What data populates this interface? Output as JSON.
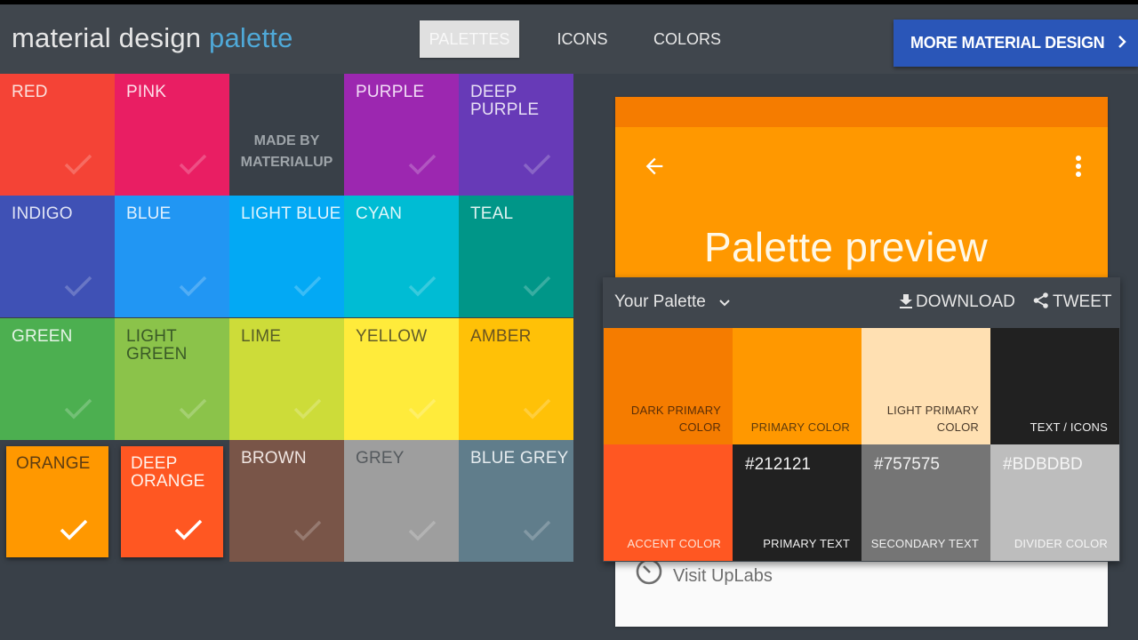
{
  "header": {
    "logo_main": "material design ",
    "logo_accent": "palette",
    "nav": [
      {
        "label": "PALETTES",
        "active": true
      },
      {
        "label": "ICONS",
        "active": false
      },
      {
        "label": "COLORS",
        "active": false
      }
    ],
    "more_button": "MORE MATERIAL DESIGN",
    "more_button_icon": "chevron-right-icon"
  },
  "grid": {
    "tiles": [
      {
        "name": "RED",
        "color": "#f44336",
        "text": "#fbe0dd",
        "selected": false
      },
      {
        "name": "PINK",
        "color": "#e91e63",
        "text": "#fce0ea",
        "selected": false
      },
      {
        "name": "MADE_BY",
        "color": "#394048",
        "text": "#9ea4a9",
        "selected": false
      },
      {
        "name": "PURPLE",
        "color": "#9c27b0",
        "text": "#f2ddf6",
        "selected": false
      },
      {
        "name": "DEEP PURPLE",
        "color": "#673ab7",
        "text": "#e7dff4",
        "selected": false
      },
      {
        "name": "INDIGO",
        "color": "#3f51b5",
        "text": "#e0e4f5",
        "selected": false
      },
      {
        "name": "BLUE",
        "color": "#2196f3",
        "text": "#e1f0fd",
        "selected": false
      },
      {
        "name": "LIGHT BLUE",
        "color": "#03a9f4",
        "text": "#e0f4fd",
        "selected": false
      },
      {
        "name": "CYAN",
        "color": "#00bcd4",
        "text": "#e0f7fa",
        "selected": false
      },
      {
        "name": "TEAL",
        "color": "#009688",
        "text": "#dff3f1",
        "selected": false
      },
      {
        "name": "GREEN",
        "color": "#4caf50",
        "text": "#e5f4e6",
        "selected": false
      },
      {
        "name": "LIGHT GREEN",
        "color": "#8bc34a",
        "text": "#3a5a27",
        "selected": false
      },
      {
        "name": "LIME",
        "color": "#cddc39",
        "text": "#575e26",
        "selected": false
      },
      {
        "name": "YELLOW",
        "color": "#ffeb3b",
        "text": "#625c2a",
        "selected": false
      },
      {
        "name": "AMBER",
        "color": "#ffc107",
        "text": "#6a5420",
        "selected": false
      },
      {
        "name": "ORANGE",
        "color": "#ff9800",
        "text": "#5e3d12",
        "selected": true
      },
      {
        "name": "DEEP ORANGE",
        "color": "#ff5722",
        "text": "#fff1ea",
        "selected": true
      },
      {
        "name": "BROWN",
        "color": "#795548",
        "text": "#f0e6e2",
        "selected": false
      },
      {
        "name": "GREY",
        "color": "#9e9e9e",
        "text": "#555a5e",
        "selected": false
      },
      {
        "name": "BLUE GREY",
        "color": "#607d8b",
        "text": "#e6ecef",
        "selected": false
      }
    ],
    "made_by_line1": "MADE BY",
    "made_by_line2": "MATERIALUP"
  },
  "preview": {
    "title": "Palette preview",
    "visit_label": "Visit UpLabs",
    "status_color": "#f57c00",
    "appbar_color": "#ff9800"
  },
  "palette_panel": {
    "select_label": "Your Palette",
    "download_label": "DOWNLOAD",
    "tweet_label": "TWEET",
    "swatches": [
      {
        "label": "DARK PRIMARY\nCOLOR",
        "color": "#f57c00",
        "text": "#5a2e07",
        "hex": ""
      },
      {
        "label": "PRIMARY COLOR",
        "color": "#ff9800",
        "text": "#5e3a0c",
        "hex": ""
      },
      {
        "label": "LIGHT PRIMARY\nCOLOR",
        "color": "#ffe0b2",
        "text": "#4a3a2a",
        "hex": ""
      },
      {
        "label": "TEXT / ICONS",
        "color": "#212121",
        "text": "#f0f0f0",
        "hex": ""
      },
      {
        "label": "ACCENT COLOR",
        "color": "#ff5722",
        "text": "#fde3d7",
        "hex": ""
      },
      {
        "label": "PRIMARY TEXT",
        "color": "#212121",
        "text": "#f0f0f0",
        "hex": "#212121"
      },
      {
        "label": "SECONDARY TEXT",
        "color": "#757575",
        "text": "#f0f0f0",
        "hex": "#757575"
      },
      {
        "label": "DIVIDER COLOR",
        "color": "#bdbdbd",
        "text": "#f5f5f5",
        "hex": "#BDBDBD"
      }
    ]
  }
}
